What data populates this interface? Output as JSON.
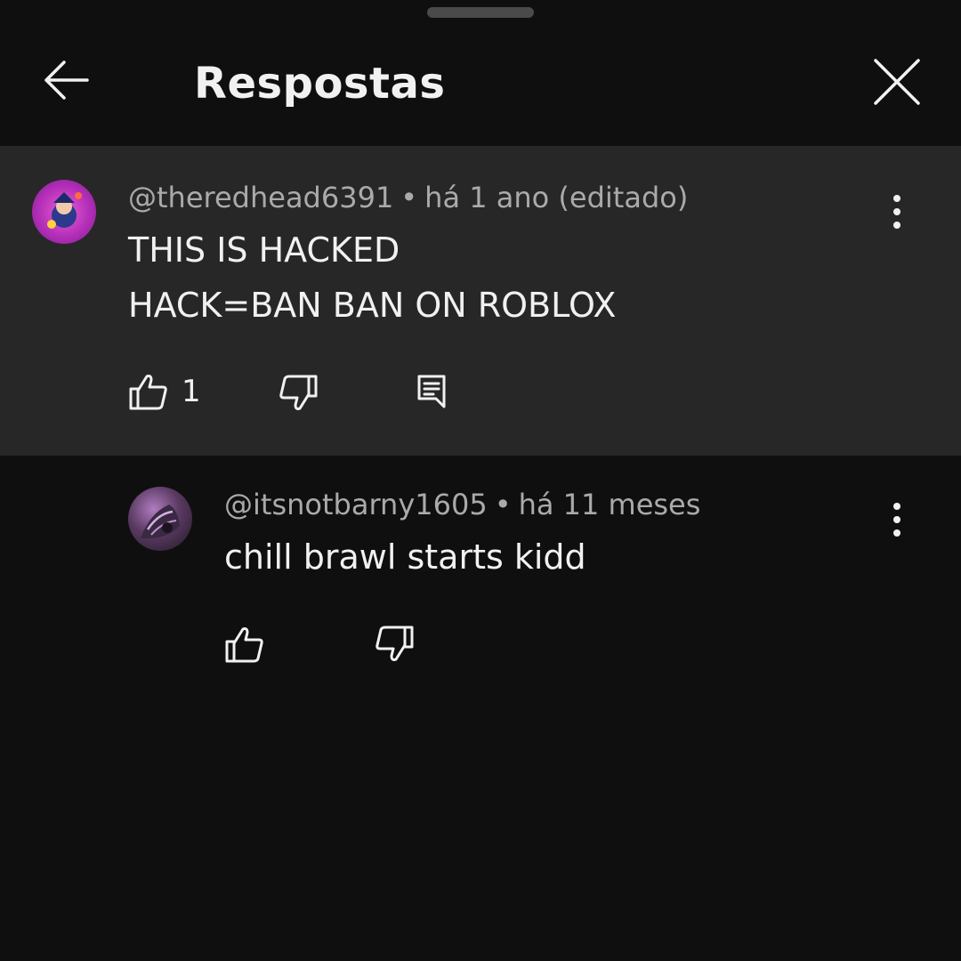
{
  "header": {
    "title": "Respostas"
  },
  "comments": [
    {
      "author": "@theredhead6391",
      "separator": "•",
      "time": "há 1 ano (editado)",
      "lines": [
        "THIS IS HACKED",
        "HACK=BAN BAN ON ROBLOX"
      ],
      "likes": "1"
    },
    {
      "author": "@itsnotbarny1605",
      "separator": "•",
      "time": "há 11 meses",
      "lines": [
        "chill brawl starts kidd"
      ]
    }
  ],
  "colors": {
    "background": "#0f0f0f",
    "highlight": "#272727",
    "text": "#f1f1f1",
    "secondary_text": "#aaaaaa"
  },
  "icons": {
    "back": "arrow-left-icon",
    "close": "close-icon",
    "more": "more-vertical-icon",
    "like": "thumbs-up-icon",
    "dislike": "thumbs-down-icon",
    "reply": "reply-comment-icon"
  }
}
